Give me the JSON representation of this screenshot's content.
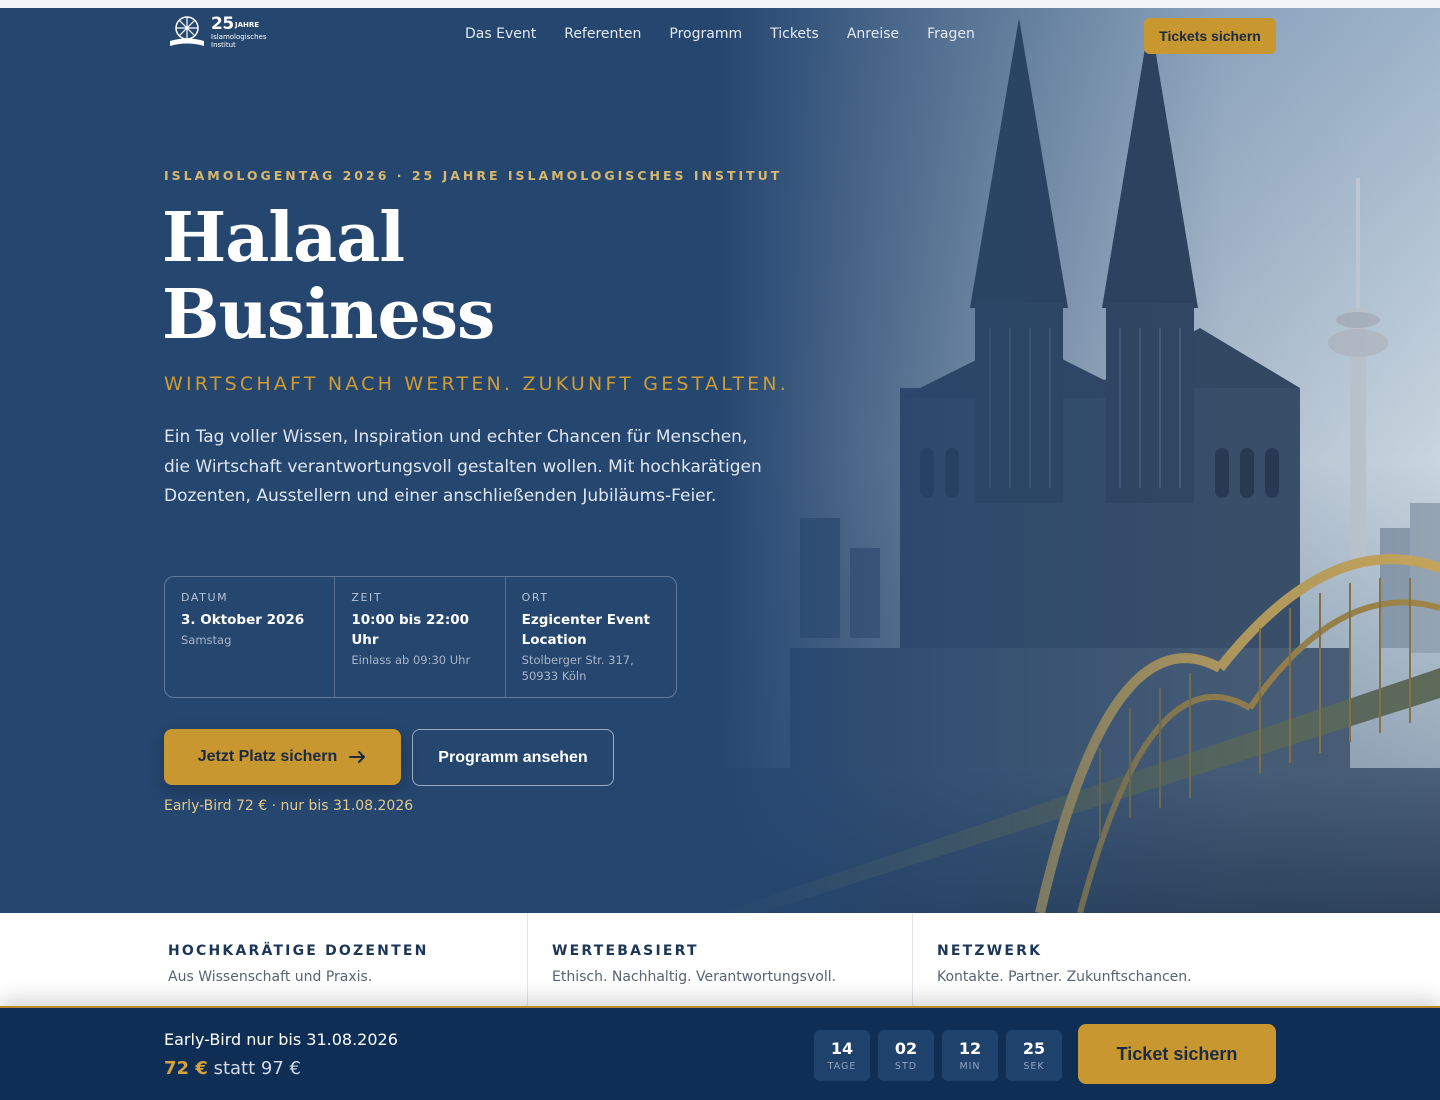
{
  "nav": {
    "logo": {
      "number": "25",
      "jahre": "JAHRE",
      "institute": "Islamologisches Institut"
    },
    "links": [
      "Das Event",
      "Referenten",
      "Programm",
      "Tickets",
      "Anreise",
      "Fragen"
    ],
    "cta": "Tickets sichern"
  },
  "hero": {
    "eyebrow": "ISLAMOLOGENTAG 2026 · 25 JAHRE ISLAMOLOGISCHES INSTITUT",
    "title_line1": "Halaal",
    "title_line2": "Business",
    "tagline": "WIRTSCHAFT NACH WERTEN. ZUKUNFT GESTALTEN.",
    "intro": "Ein Tag voller Wissen, Inspiration und echter Chancen für Menschen, die Wirtschaft verantwortungsvoll gestalten wollen. Mit hochkarätigen Dozenten, Ausstellern und einer anschließenden Jubiläums-Feier.",
    "info": {
      "date": {
        "label": "DATUM",
        "main": "3. Oktober 2026",
        "sub": "Samstag"
      },
      "time": {
        "label": "ZEIT",
        "main": "10:00 bis 22:00 Uhr",
        "sub": "Einlass ab 09:30 Uhr"
      },
      "place": {
        "label": "ORT",
        "main": "Ezgicenter Event Location",
        "sub": "Stolberger Str. 317, 50933 Köln"
      }
    },
    "primary_button": "Jetzt Platz sichern",
    "secondary_button": "Programm ansehen",
    "early_bird_note": "Early-Bird 72 € · nur bis 31.08.2026"
  },
  "features": [
    {
      "title": "HOCHKARÄTIGE DOZENTEN",
      "text": "Aus Wissenschaft und Praxis."
    },
    {
      "title": "WERTEBASIERT",
      "text": "Ethisch. Nachhaltig. Verantwortungsvoll."
    },
    {
      "title": "NETZWERK",
      "text": "Kontakte. Partner. Zukunftschancen."
    }
  ],
  "sticky_bar": {
    "title": "Early-Bird nur bis 31.08.2026",
    "price_now": "72 €",
    "price_old": "statt 97 €",
    "countdown": [
      {
        "value": "14",
        "label": "TAGE"
      },
      {
        "value": "02",
        "label": "STD"
      },
      {
        "value": "12",
        "label": "MIN"
      },
      {
        "value": "25",
        "label": "SEK"
      }
    ],
    "cta": "Ticket sichern"
  },
  "colors": {
    "hero_bg": "#25466f",
    "accent_gold": "#c9972f",
    "sticky_bg": "#0f2e56",
    "feature_title": "#1c3658"
  },
  "icons": [
    "logo-emblem-icon",
    "arrow-right-icon"
  ]
}
